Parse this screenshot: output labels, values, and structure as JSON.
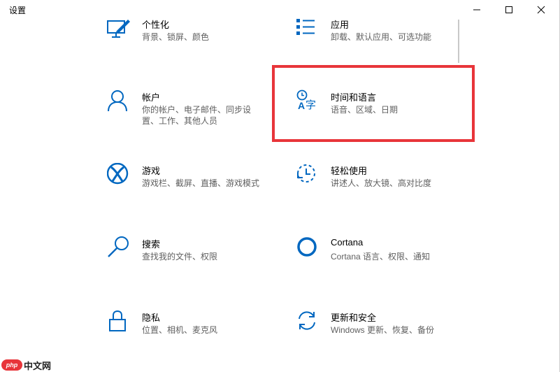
{
  "window": {
    "title": "设置",
    "controls": {
      "minimize": "minimize-icon",
      "maximize": "maximize-icon",
      "close": "close-icon"
    }
  },
  "accent_color": "#0067c0",
  "highlight_color": "#e8353a",
  "tiles": [
    {
      "title": "个性化",
      "desc": "背景、锁屏、颜色",
      "icon": "personalization-icon"
    },
    {
      "title": "应用",
      "desc": "卸载、默认应用、可选功能",
      "icon": "apps-icon"
    },
    {
      "title": "帐户",
      "desc": "你的帐户、电子邮件、同步设置、工作、其他人员",
      "icon": "account-icon"
    },
    {
      "title": "时间和语言",
      "desc": "语音、区域、日期",
      "icon": "time-language-icon"
    },
    {
      "title": "游戏",
      "desc": "游戏栏、截屏、直播、游戏模式",
      "icon": "xbox-icon"
    },
    {
      "title": "轻松使用",
      "desc": "讲述人、放大镜、高对比度",
      "icon": "ease-of-access-icon"
    },
    {
      "title": "搜索",
      "desc": "查找我的文件、权限",
      "icon": "search-icon"
    },
    {
      "title": "Cortana",
      "desc": "Cortana 语言、权限、通知",
      "icon": "cortana-icon"
    },
    {
      "title": "隐私",
      "desc": "位置、相机、麦克风",
      "icon": "lock-icon"
    },
    {
      "title": "更新和安全",
      "desc": "Windows 更新、恢复、备份",
      "icon": "update-icon"
    }
  ],
  "watermark": {
    "logo": "php",
    "text": "中文网"
  }
}
